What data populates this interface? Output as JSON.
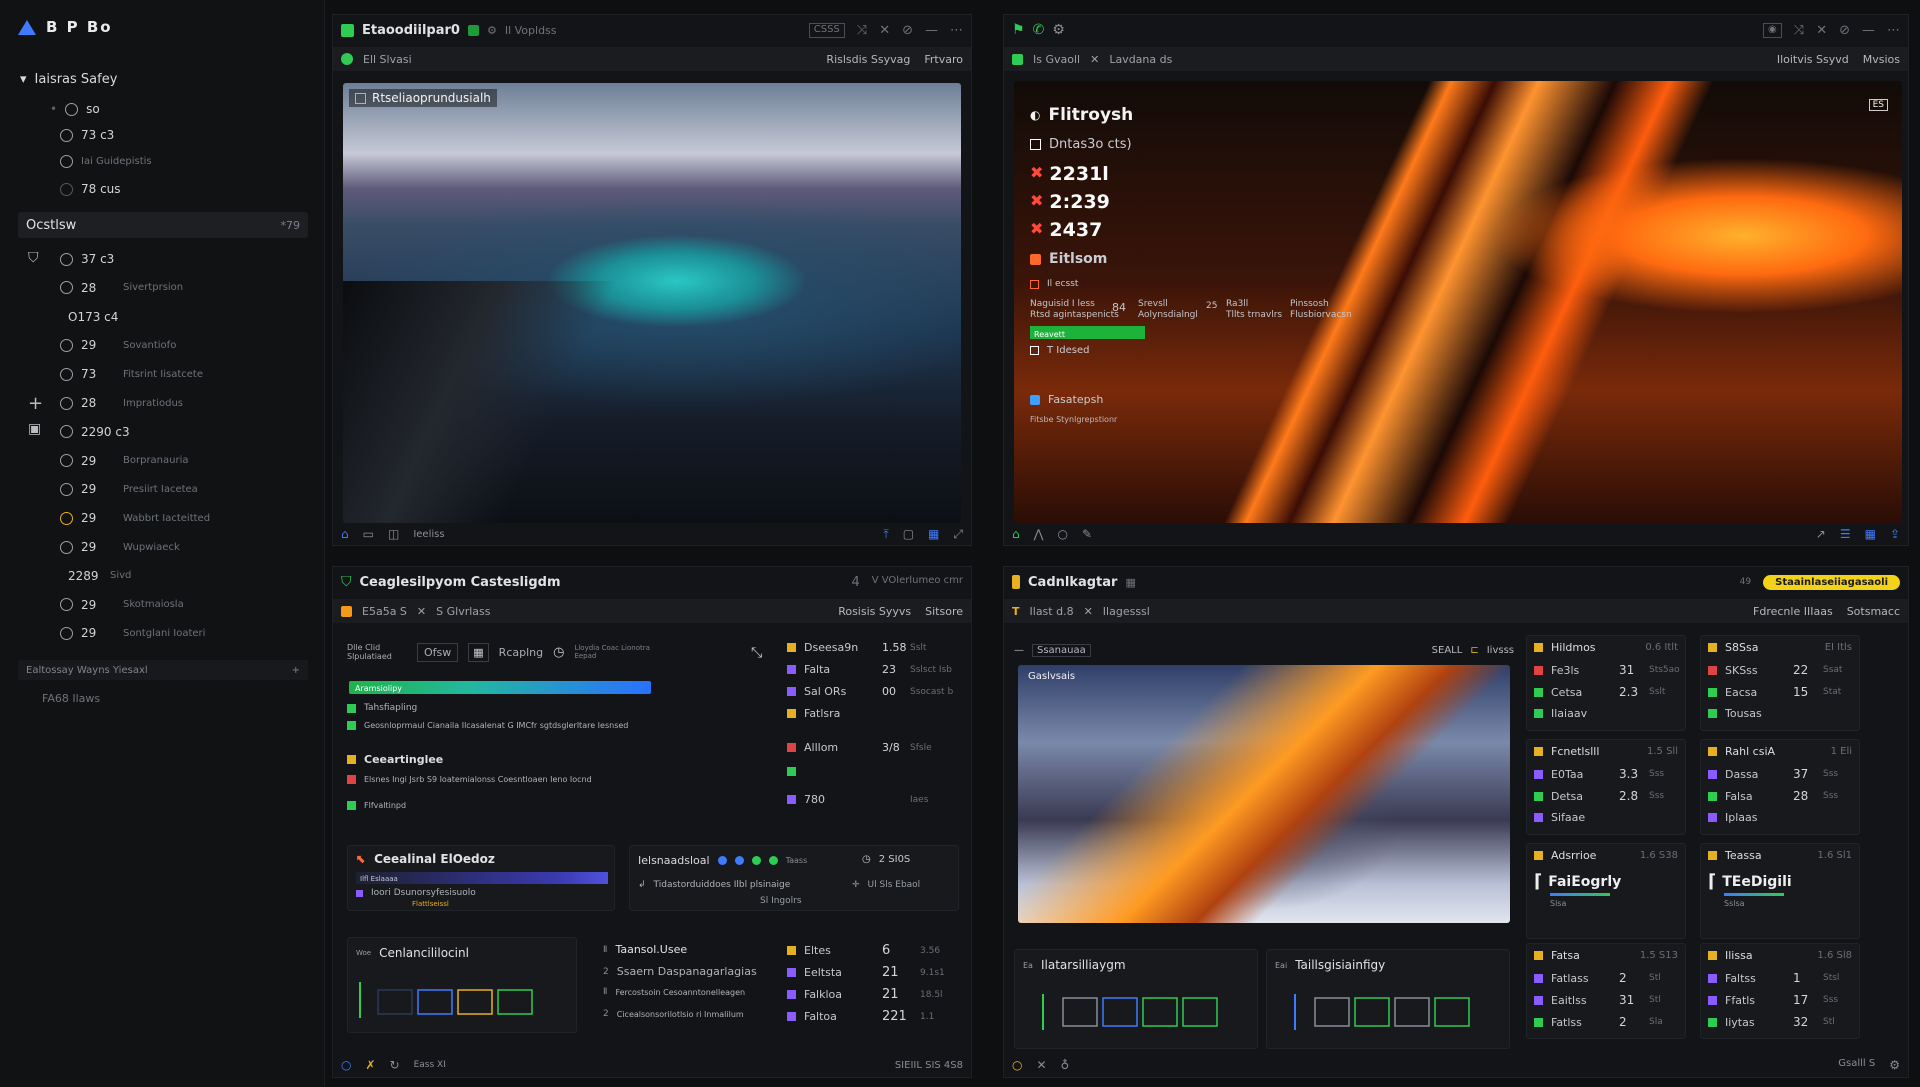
{
  "sidebar": {
    "brand": "B P Bo",
    "section1": {
      "title": "Iaisras Safey"
    },
    "section1_items": [
      {
        "value": "so",
        "sub": ""
      },
      {
        "value": "73 c3",
        "sub": ""
      },
      {
        "value": "",
        "sub": "Iai Guidepistis"
      },
      {
        "value": "78 cus",
        "sub": ""
      }
    ],
    "group": {
      "title": "Ocstlsw",
      "badge": "*79"
    },
    "group_items": [
      {
        "value": "37 c3",
        "sub": ""
      },
      {
        "value": "28",
        "sub": "Sivertprsion"
      },
      {
        "value": "O173 c4",
        "sub": ""
      },
      {
        "value": "29",
        "sub": "Sovantiofo"
      },
      {
        "value": "73",
        "sub": "Fitsrint Iisatcete"
      },
      {
        "value": "28",
        "sub": "Impratiodus"
      },
      {
        "value": "2290 c3",
        "sub": ""
      },
      {
        "value": "29",
        "sub": "Borpranauria"
      },
      {
        "value": "29",
        "sub": "Presiirt Iacetea"
      },
      {
        "value": "29",
        "sub": "Wabbrt Iacteitted"
      },
      {
        "value": "29",
        "sub": "Wupwiaeck"
      },
      {
        "value": "2289",
        "sub": "Sivd"
      },
      {
        "value": "29",
        "sub": "Skotmaiosla"
      },
      {
        "value": "29",
        "sub": "Sontglani Ioateri"
      }
    ],
    "workspace_bar": "Ealtossay Wayns Yiesaxl",
    "workspace_plus": "+",
    "footer_item": "FA68 Ilaws"
  },
  "panel_a": {
    "title": "Etaoodiilpar0",
    "subtitle": "Il Vopldss",
    "ctrl_label": "CSSS",
    "tab_label": "Ell Slvasi",
    "tab_right1": "Rislsdis Ssyvag",
    "tab_right2": "Frtvaro",
    "image_label": "Rtseliaoprundusialh",
    "footer_label": "Ieeliss"
  },
  "panel_b": {
    "tab_label": "Is Gvaoll",
    "tab_label2": "Lavdana ds",
    "tab_right1": "Iloitvis Ssyvd",
    "tab_right2": "Mvsios",
    "hud_title": "Flitroysh",
    "hud_sub1": "Dntas3o cts)",
    "hud_values": [
      "2231l",
      "2:239",
      "2437"
    ],
    "hud_sub2": "Eitlsom",
    "hud_sub3": "Il ecsst",
    "hud_cols": [
      "Naguisid I less",
      "Rtsd agintaspenicts",
      "84",
      "Srevsll",
      "Aolynsdialngl",
      "25",
      "Ra3ll",
      "Tllts trnavlrs",
      "Pinssosh",
      "Flusbiorvacsn"
    ],
    "green_label": "Reavett",
    "hud_sub4": "T Idesed",
    "hud_sub5": "Fasatepsh",
    "hud_sub6": "Fitsbe Stynlgrepstionr",
    "badge": "ES"
  },
  "panel_c": {
    "title": "Ceaglesilpyom Castesligdm",
    "counter": "4",
    "ctrl": "V VOlerlumeo cmr",
    "tab_label": "E5a5a S",
    "tab_label2": "S Glvrlass",
    "tab_right1": "Rosisis Syyvs",
    "tab_right2": "Sitsore",
    "toolbar": [
      "Dlle Clid Slpulatiaed",
      "Ofsw",
      "Rcaplng",
      "Lloydia Coac Lionotra Eepad"
    ],
    "progress_label": "Aramsiolipy",
    "progress_pct": 72,
    "items": [
      "Tahsfiapling",
      "Geosnloprmaul Cianaila Ilcasalenat G IMCfr sgtdsglerltare Iesnsed",
      "Ceeartinglee",
      "Elsnes Ingi Jsrb S9 Ioatemialonss Coesntloaen Ieno Iocnd",
      "Flfvaltinpd"
    ],
    "right_list": [
      {
        "name": "Dseesa9n",
        "val": "1.58",
        "unit": "Sslt"
      },
      {
        "name": "Falta",
        "val": "23",
        "unit": "Sslsct Isb"
      },
      {
        "name": "Sal ORs",
        "val": "00",
        "unit": "Ssocast b"
      },
      {
        "name": "Fatlsra",
        "val": "",
        "unit": ""
      },
      {
        "name": "Alllom",
        "val": "3/8",
        "unit": "Sfsle"
      },
      {
        "name": "",
        "val": "",
        "unit": ""
      },
      {
        "name": "780",
        "val": "",
        "unit": "Iaes"
      }
    ],
    "card1_title": "Ceealinal ElOedoz",
    "card1_a": "Ilfl Eslaaaa",
    "card1_b": "Ioori Dsunorsyfesisuolo",
    "card1_c": "Flattlseissl",
    "card2_title": "Ielsnaadsloal",
    "card2_right": "Taass",
    "card2_val": "2 SI0S",
    "card2_line": "Tidastorduiddoes Ilbl plsinaige",
    "card2_line2": "Sl Ingolrs",
    "card2_right2": "Ul Sls Ebaol",
    "bottom_chart_title": "Cenlancililocinl",
    "bottom_chart_prefix": "Woe",
    "bottom_list": [
      "Taansol.Usee",
      "Ssaern Daspanagarlagias",
      "Fercostsoin Cesoanntonelleagen",
      "Cicealsonsorilotlsio ri Inmalilum"
    ],
    "bottom_right": [
      {
        "name": "Eltes",
        "val": "6",
        "unit": "3.56"
      },
      {
        "name": "Eeltsta",
        "val": "21",
        "unit": "9.1s1"
      },
      {
        "name": "Falkloa",
        "val": "21",
        "unit": "18.5l"
      },
      {
        "name": "Faltoa",
        "val": "221",
        "unit": "1.1"
      }
    ],
    "footer_left": "Eass XI",
    "footer_right": "SIEIIL SIS 4S8"
  },
  "panel_d": {
    "title": "Cadnlkagtar",
    "badge": "49",
    "yellow_btn": "Staainlaseiiagasaoli",
    "tab_label": "Ilast d.8",
    "tab_label2": "Ilagesssl",
    "tab_right1": "Fdrecnle IIIaas",
    "tab_right2": "Sotsmacc",
    "view_label": "Ssanauaa",
    "view_right": "SEALL",
    "view_right2": "Iivsss",
    "image_label": "Gaslvsais",
    "col1": [
      {
        "head": "Hildmos",
        "headv": "0.6 Itlt",
        "rows": [
          [
            "Fe3ls",
            "31",
            "Sts5ao"
          ],
          [
            "Cetsa",
            "2.3",
            "Sslt"
          ],
          [
            "Ilaiaav",
            "",
            ""
          ]
        ]
      },
      {
        "head": "Fcnetlslll",
        "headv": "1.5 Sll",
        "rows": [
          [
            "E0Taa",
            "3.3",
            "Sss"
          ],
          [
            "Detsa",
            "2.8",
            "Sss"
          ],
          [
            "Sifaae",
            "",
            ""
          ]
        ]
      },
      {
        "head": "Adsrrioe",
        "headv": "1.6 S38",
        "big": "FaiEogrly",
        "big_sub": "Slsa"
      },
      {
        "head": "Fatsa",
        "headv": "1.5 S13",
        "rows": [
          [
            "Fatlass",
            "2",
            "Stl"
          ],
          [
            "Eaitlss",
            "31",
            "Stl"
          ],
          [
            "Fatlss",
            "2",
            "Sla"
          ]
        ]
      }
    ],
    "col2": [
      {
        "head": "S8Ssa",
        "headv": "EI Itls",
        "rows": [
          [
            "SKSss",
            "22",
            "Ssat"
          ],
          [
            "Eacsa",
            "15",
            "Stat"
          ],
          [
            "Tousas",
            "",
            ""
          ]
        ]
      },
      {
        "head": "Rahl csiA",
        "headv": "1 Eli",
        "rows": [
          [
            "Dassa",
            "37",
            "Sss"
          ],
          [
            "Falsa",
            "28",
            "Sss"
          ],
          [
            "Iplaas",
            "",
            ""
          ]
        ]
      },
      {
        "head": "Teassa",
        "headv": "1.6 Sl1",
        "big": "TEeDigili",
        "big_sub": "Sslsa"
      },
      {
        "head": "Ilissa",
        "headv": "1.6 Sl8",
        "rows": [
          [
            "Faltss",
            "1",
            "Stsl"
          ],
          [
            "Ffatls",
            "17",
            "Sss"
          ],
          [
            "Iiytas",
            "32",
            "Stl"
          ]
        ]
      }
    ],
    "chart1_title": "Ilatarsilliaygm",
    "chart1_prefix": "Ea",
    "chart2_title": "Taillsgisiainfigy",
    "chart2_prefix": "Eai",
    "footer_right": "Gsalll S"
  },
  "colors": {
    "accent_green": "#2ecc52",
    "accent_yellow": "#f3d21a",
    "accent_blue": "#3f7bff",
    "accent_orange": "#ff7a1a"
  }
}
